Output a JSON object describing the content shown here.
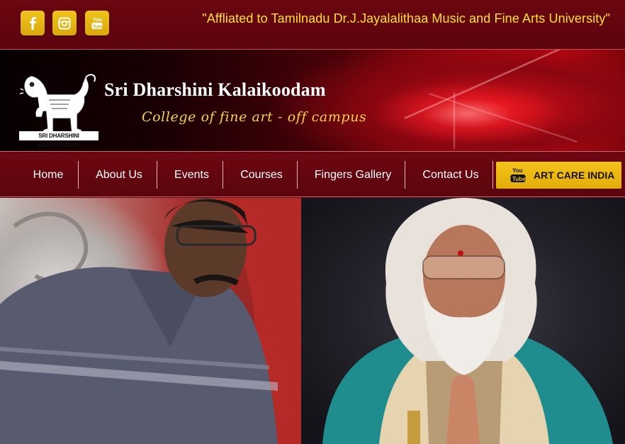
{
  "colors": {
    "maroon": "#5c040c",
    "gold": "#f1c41c",
    "tagline_yellow": "#ffe033",
    "subtitle_gold": "#f6d24a"
  },
  "social": [
    {
      "icon": "facebook-icon"
    },
    {
      "icon": "instagram-icon"
    },
    {
      "icon": "youtube-icon"
    }
  ],
  "header": {
    "tagline": "\"Affliated to Tamilnadu Dr.J.Jayalalithaa Music and Fine Arts University\""
  },
  "banner": {
    "logo_caption": "SRI DHARSHINI KALAIKOODAM",
    "title": "Sri Dharshini Kalaikoodam",
    "subtitle": "College of fine art - off campus"
  },
  "nav": {
    "items": [
      "Home",
      "About Us",
      "Events",
      "Courses",
      "Fingers Gallery",
      "Contact Us"
    ],
    "cta_label": "ART CARE INDIA",
    "cta_icon": "youtube-icon"
  },
  "hero": {
    "image": "photo-two-men"
  }
}
